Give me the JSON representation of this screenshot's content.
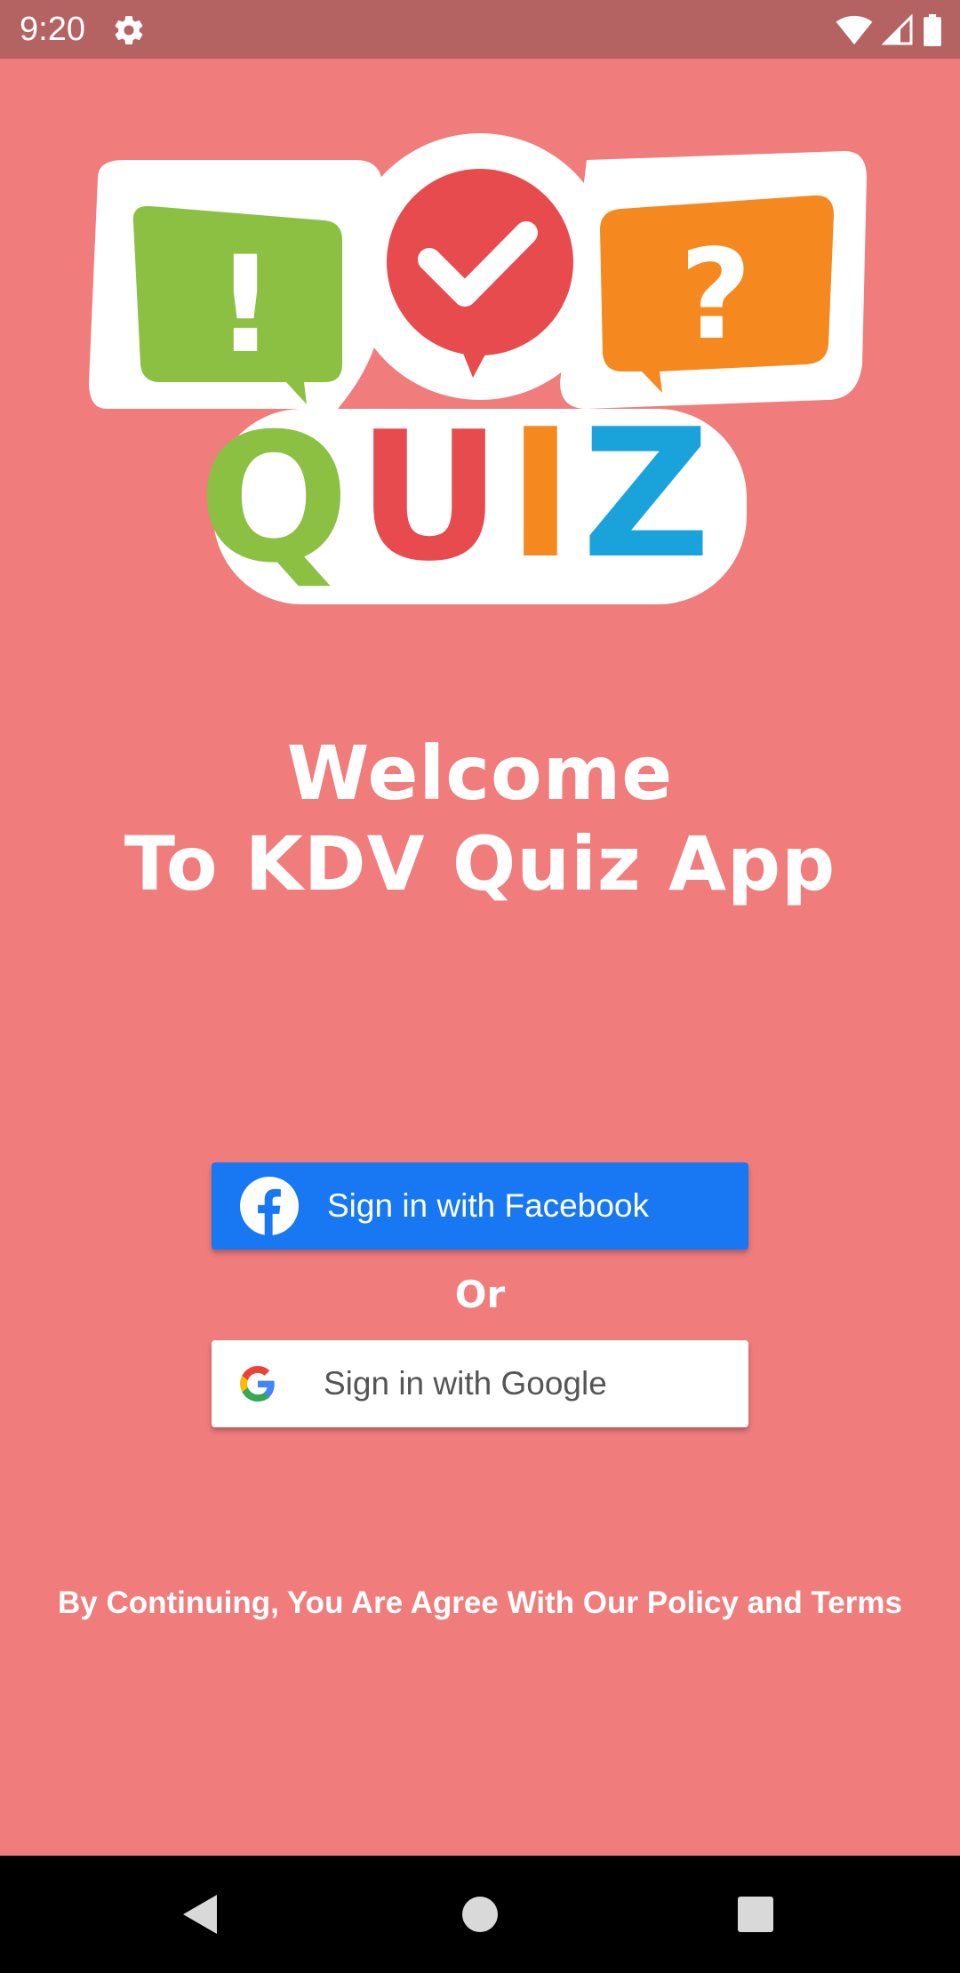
{
  "status_bar": {
    "time": "9:20",
    "icons": [
      "settings-gear-icon",
      "wifi-icon",
      "cellular-signal-icon",
      "battery-icon"
    ]
  },
  "logo": {
    "letters": [
      "Q",
      "U",
      "I",
      "Z"
    ],
    "bubble_symbols": [
      "!",
      "?"
    ],
    "colors": {
      "green": "#8bc043",
      "red": "#e84b4e",
      "orange": "#f5891f",
      "blue": "#1aa3db"
    }
  },
  "welcome": {
    "line1": "Welcome",
    "line2": "To KDV Quiz App"
  },
  "buttons": {
    "facebook_label": "Sign in with Facebook",
    "or_label": "Or",
    "google_label": "Sign in with Google"
  },
  "terms_text": "By Continuing, You Are Agree With Our Policy and Terms",
  "nav_bar": {
    "icons": [
      "back-icon",
      "home-icon",
      "recents-icon"
    ]
  },
  "colors": {
    "background": "#f07c7c",
    "status_bar": "#b46262",
    "facebook": "#1877f2"
  }
}
